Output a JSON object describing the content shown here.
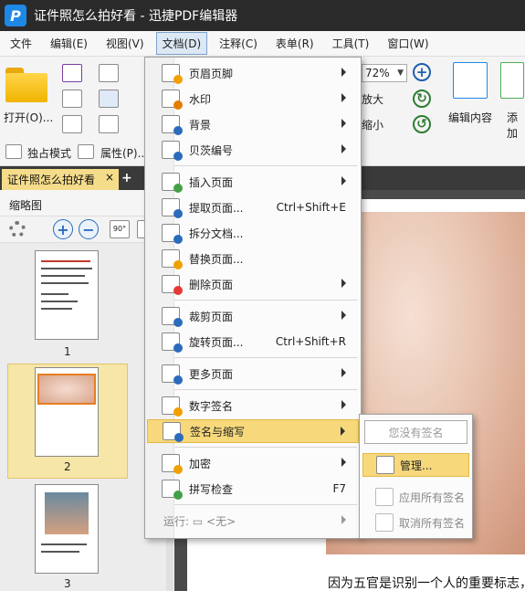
{
  "window": {
    "title": "证件照怎么拍好看 - 迅捷PDF编辑器",
    "logo": "P"
  },
  "menubar": [
    "文件",
    "编辑(E)",
    "视图(V)",
    "文档(D)",
    "注释(C)",
    "表单(R)",
    "工具(T)",
    "窗口(W)"
  ],
  "ribbon": {
    "open_label": "打开(O)...",
    "zoom_value": "72%",
    "enlarge_label": "放大",
    "shrink_label": "缩小",
    "edit_content_label": "编辑内容",
    "add_label": "添加",
    "exclusive_mode_label": "独占模式",
    "properties_label": "属性(P)..."
  },
  "tabs": {
    "doc_tab": "证件照怎么拍好看",
    "close": "×",
    "add": "+"
  },
  "sidepanel": {
    "title": "缩略图",
    "rotate_label": "90°",
    "pages": [
      "1",
      "2",
      "3"
    ]
  },
  "document": {
    "body_text": "因为五官是识别一个人的重要标志，"
  },
  "dropdown": {
    "items": [
      {
        "label": "页眉页脚",
        "shortcut": "",
        "icon": "header-footer-icon"
      },
      {
        "label": "水印",
        "shortcut": "",
        "icon": "watermark-icon"
      },
      {
        "label": "背景",
        "shortcut": "",
        "icon": "background-icon"
      },
      {
        "label": "贝茨编号",
        "shortcut": "",
        "icon": "bates-numbering-icon"
      },
      {
        "label": "插入页面",
        "shortcut": "",
        "icon": "insert-page-icon"
      },
      {
        "label": "提取页面...",
        "shortcut": "Ctrl+Shift+E",
        "icon": "extract-page-icon"
      },
      {
        "label": "拆分文档...",
        "shortcut": "",
        "icon": "split-document-icon"
      },
      {
        "label": "替换页面...",
        "shortcut": "",
        "icon": "replace-page-icon"
      },
      {
        "label": "删除页面",
        "shortcut": "",
        "icon": "delete-page-icon"
      },
      {
        "label": "裁剪页面",
        "shortcut": "",
        "icon": "crop-page-icon"
      },
      {
        "label": "旋转页面...",
        "shortcut": "Ctrl+Shift+R",
        "icon": "rotate-page-icon"
      },
      {
        "label": "更多页面",
        "shortcut": "",
        "icon": "more-pages-icon"
      },
      {
        "label": "数字签名",
        "shortcut": "",
        "icon": "digital-signature-icon"
      },
      {
        "label": "签名与缩写",
        "shortcut": "",
        "icon": "signature-initials-icon"
      },
      {
        "label": "加密",
        "shortcut": "",
        "icon": "encrypt-icon"
      },
      {
        "label": "拼写检查",
        "shortcut": "F7",
        "icon": "spell-check-icon"
      },
      {
        "label": "运行: ▭ <无>",
        "shortcut": "",
        "icon": ""
      }
    ]
  },
  "submenu": {
    "no_signature": "您没有签名",
    "manage": "管理...",
    "apply_all": "应用所有签名",
    "cancel_all": "取消所有签名"
  }
}
